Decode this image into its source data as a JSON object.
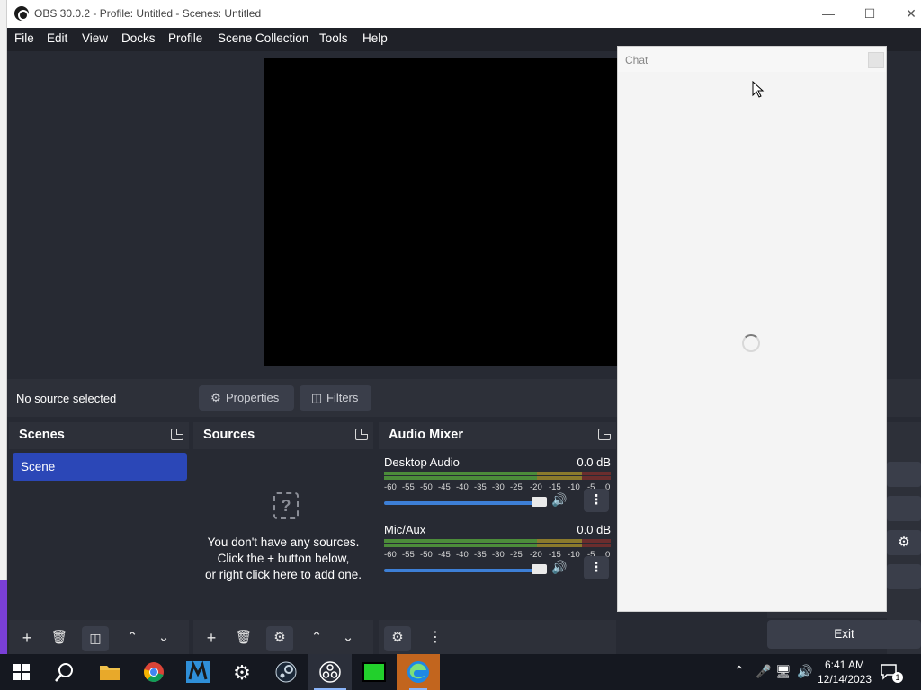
{
  "window": {
    "title": "OBS 30.0.2 - Profile: Untitled - Scenes: Untitled",
    "controls": [
      "minimize",
      "maximize",
      "close"
    ]
  },
  "menu": [
    "File",
    "Edit",
    "View",
    "Docks",
    "Profile",
    "Scene Collection",
    "Tools",
    "Help"
  ],
  "source_toolbar": {
    "status": "No source selected",
    "properties_label": "Properties",
    "filters_label": "Filters"
  },
  "scenes": {
    "title": "Scenes",
    "items": [
      "Scene"
    ]
  },
  "sources": {
    "title": "Sources",
    "empty_line1": "You don't have any sources.",
    "empty_line2": "Click the + button below,",
    "empty_line3": "or right click here to add one."
  },
  "mixer": {
    "title": "Audio Mixer",
    "ticks": [
      "-60",
      "-55",
      "-50",
      "-45",
      "-40",
      "-35",
      "-30",
      "-25",
      "-20",
      "-15",
      "-10",
      "-5",
      "0"
    ],
    "channels": [
      {
        "name": "Desktop Audio",
        "db": "0.0 dB",
        "volume": 1.0
      },
      {
        "name": "Mic/Aux",
        "db": "0.0 dB",
        "volume": 1.0
      }
    ]
  },
  "controls": {
    "exit_label": "Exit"
  },
  "chat": {
    "title": "Chat"
  },
  "taskbar": {
    "apps": [
      "windows-start",
      "search",
      "file-explorer",
      "chrome",
      "app-m",
      "settings",
      "steam",
      "obs",
      "nvidia",
      "edge"
    ],
    "time": "6:41 AM",
    "date": "12/14/2023",
    "notification_count": "1"
  },
  "colors": {
    "accent": "#2b47b7",
    "panel": "#2d3039",
    "background": "#272a33",
    "slider": "#3d7fd6"
  }
}
